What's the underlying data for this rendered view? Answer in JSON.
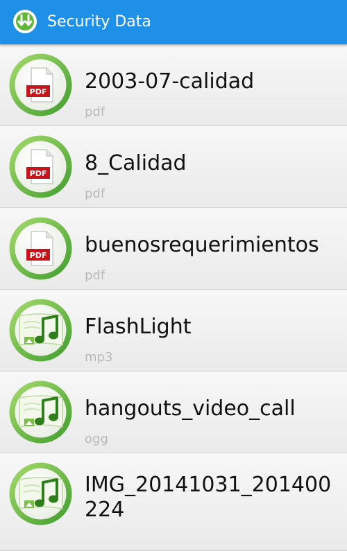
{
  "app": {
    "title": "Security Data",
    "icon": "download-arrows-icon",
    "accent": "#1e90e8"
  },
  "files": [
    {
      "name": "2003-07-calidad",
      "ext": "pdf",
      "icon": "pdf-file-icon"
    },
    {
      "name": "8_Calidad",
      "ext": "pdf",
      "icon": "pdf-file-icon"
    },
    {
      "name": "buenosrequerimientos",
      "ext": "pdf",
      "icon": "pdf-file-icon"
    },
    {
      "name": "FlashLight",
      "ext": "mp3",
      "icon": "music-file-icon"
    },
    {
      "name": "hangouts_video_call",
      "ext": "ogg",
      "icon": "music-file-icon"
    },
    {
      "name": "IMG_20141031_201400224",
      "ext": "",
      "icon": "music-file-icon"
    }
  ]
}
